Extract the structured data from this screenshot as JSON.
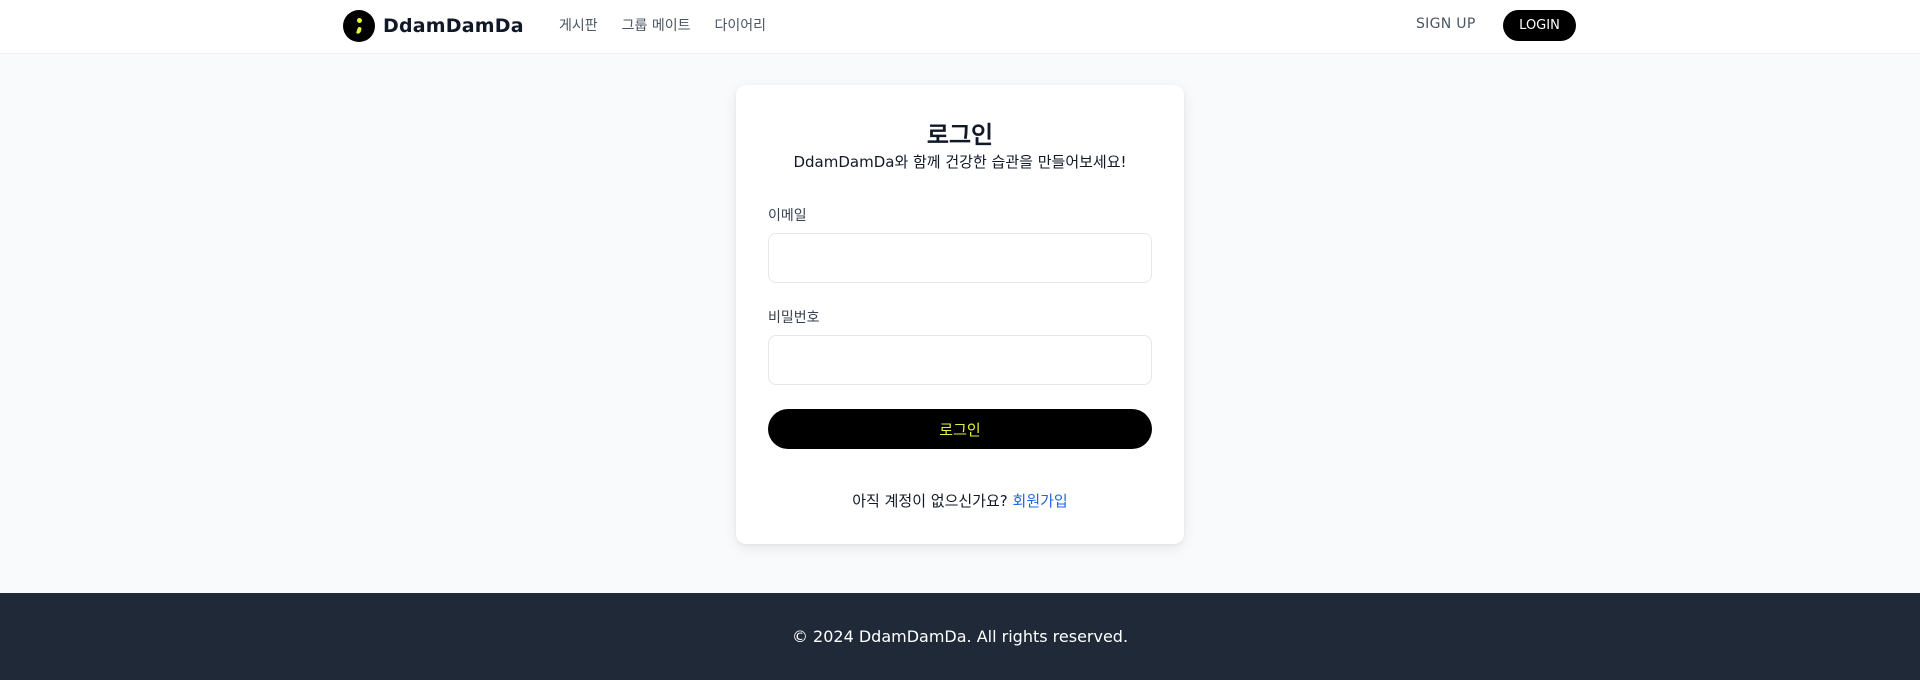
{
  "header": {
    "brand": "DdamDamDa",
    "nav": [
      {
        "label": "게시판"
      },
      {
        "label": "그룹 메이트"
      },
      {
        "label": "다이어리"
      }
    ],
    "signup_label": "SIGN UP",
    "login_label": "LOGIN"
  },
  "login_card": {
    "title": "로그인",
    "subtitle": "DdamDamDa와 함께 건강한 습관을 만들어보세요!",
    "email_label": "이메일",
    "email_value": "",
    "password_label": "비밀번호",
    "password_value": "",
    "submit_label": "로그인",
    "signup_prompt": "아직 계정이 없으신가요?",
    "signup_link": "회원가입"
  },
  "footer": {
    "copyright": "© 2024 DdamDamDa. All rights reserved."
  },
  "colors": {
    "accent_yellow": "#e6f23a",
    "link_blue": "#2563eb",
    "footer_bg": "#1f2937",
    "page_bg": "#f8fafc"
  },
  "icons": {
    "logo": "semicolon-logo-icon"
  }
}
